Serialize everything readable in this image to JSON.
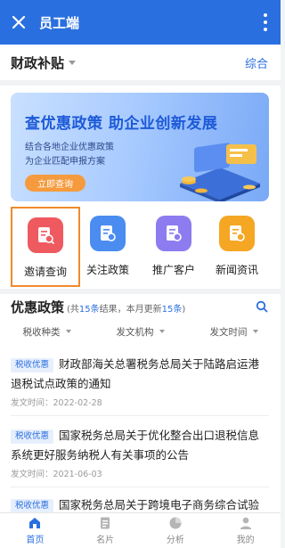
{
  "appbar": {
    "title": "员工端"
  },
  "section": {
    "name": "财政补贴",
    "switch_label": "综合"
  },
  "banner": {
    "headline": "查优惠政策 助企业创新发展",
    "line1": "结合各地企业优惠政策",
    "line2": "为企业匹配申报方案",
    "button": "立即查询"
  },
  "grid": [
    {
      "label": "邀请查询",
      "color": "#ee5a5f"
    },
    {
      "label": "关注政策",
      "color": "#4a8cf0"
    },
    {
      "label": "推广客户",
      "color": "#8c7cf0"
    },
    {
      "label": "新闻资讯",
      "color": "#f5a623"
    }
  ],
  "policy": {
    "title": "优惠政策",
    "sum_pre": "(共",
    "total": "15条",
    "sum_mid": "结果，本月更新",
    "updated": "15条",
    "sum_post": ")",
    "filters": [
      "税收种类",
      "发文机构",
      "发文时间"
    ],
    "items": [
      {
        "tag": "税收优惠",
        "title": "财政部海关总署税务总局关于陆路启运港退税试点政策的通知",
        "date": "发文时间：2022-02-28"
      },
      {
        "tag": "税收优惠",
        "title": "国家税务总局关于优化整合出口退税信息系统更好服务纳税人有关事项的公告",
        "date": "发文时间：2021-06-03"
      },
      {
        "tag": "税收优惠",
        "title": "国家税务总局关于跨境电子商务综合试验区",
        "date": ""
      }
    ]
  },
  "tabbar": [
    {
      "label": "首页",
      "icon": "home-icon",
      "active": true
    },
    {
      "label": "名片",
      "icon": "card-icon",
      "active": false
    },
    {
      "label": "分析",
      "icon": "pie-chart-icon",
      "active": false
    },
    {
      "label": "我的",
      "icon": "user-icon",
      "active": false
    }
  ]
}
